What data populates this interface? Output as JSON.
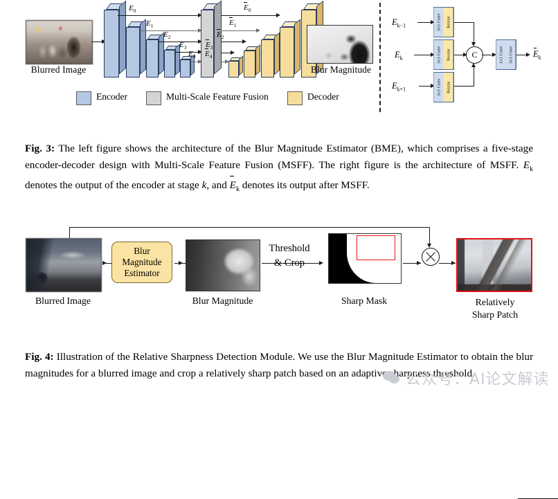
{
  "figure3": {
    "input_image_caption": "Blurred Image",
    "output_image_caption": "Blur Magnitude",
    "encoder_labels": [
      "E0",
      "E1",
      "E2",
      "E3",
      "E4"
    ],
    "decoder_labels": [
      "E0",
      "E1",
      "E2",
      "E3",
      "E4"
    ],
    "legend": [
      {
        "label": "Encoder",
        "color": "#b4c7e3"
      },
      {
        "label": "Multi-Scale Feature Fusion",
        "color": "#d4d4d4"
      },
      {
        "label": "Decoder",
        "color": "#f7dd9b"
      }
    ],
    "msff": {
      "inputs": [
        "Ek-1",
        "Ek",
        "Ek+1"
      ],
      "branch_blocks": [
        "3x3 Conv",
        "Resize"
      ],
      "concat_symbol": "C",
      "output_blocks": [
        "1x1 Conv",
        "3x3 Conv"
      ],
      "output_label": "Ek"
    }
  },
  "caption3": {
    "label": "Fig. 3:",
    "part1": " The left figure shows the architecture of the Blur Magnitude Estimator (BME), which comprises a five-stage encoder-decoder design with Multi-Scale Feature Fusion (MSFF). The right figure is the architecture of MSFF. ",
    "math1": "Ek",
    "part2": " denotes the output of the encoder at stage ",
    "math2": "k",
    "part3": ", and ",
    "math3": "Ek",
    "part4": " denotes its output after MSFF."
  },
  "figure4": {
    "input_caption": "Blurred Image",
    "bme_box_lines": [
      "Blur",
      "Magnitude",
      "Estimator"
    ],
    "blur_magnitude_caption": "Blur Magnitude",
    "threshold_label_top": "Threshold",
    "threshold_label_bottom": "& Crop",
    "sharp_mask_caption": "Sharp Mask",
    "patch_caption_line1": "Relatively",
    "patch_caption_line2": "Sharp Patch"
  },
  "caption4": {
    "label": "Fig. 4:",
    "text": " Illustration of the Relative Sharpness Detection Module. We use the Blur Magnitude Estimator to obtain the blur magnitudes for a blurred image and crop a relatively sharp patch based on an adaptive sharpness threshold."
  },
  "watermark": {
    "text": "公众号：AI论文解读"
  }
}
